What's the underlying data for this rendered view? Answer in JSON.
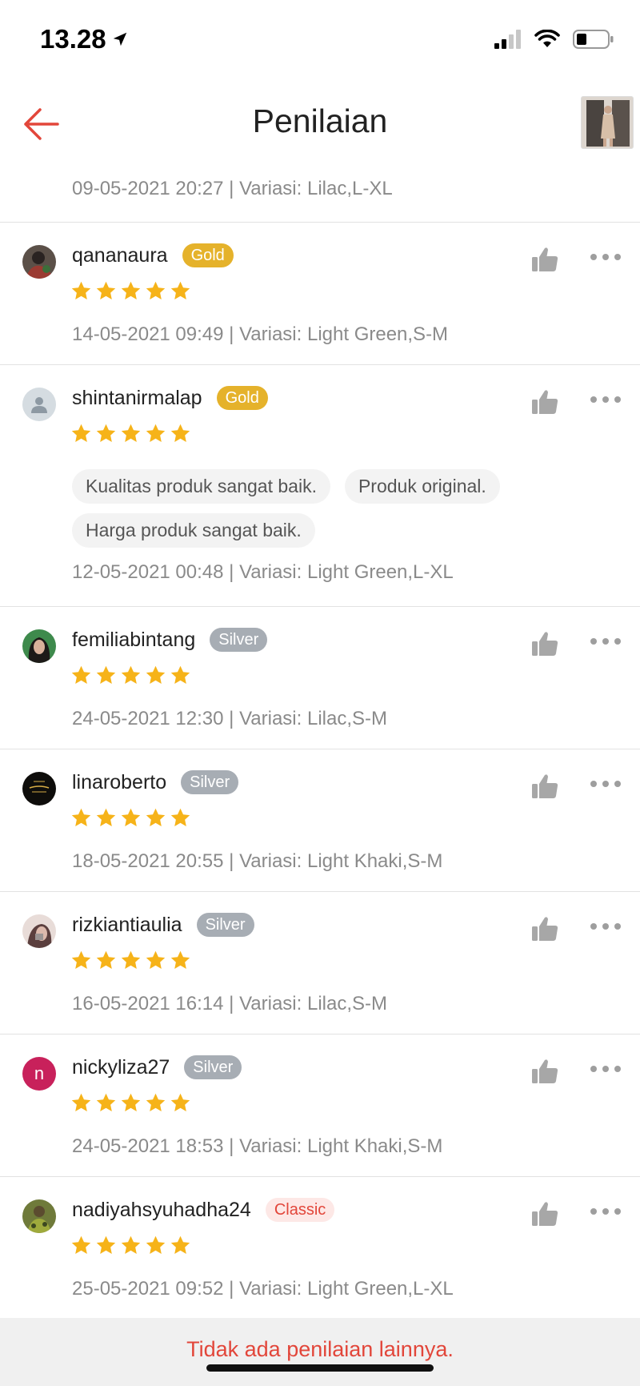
{
  "status_bar": {
    "time": "13.28"
  },
  "header": {
    "title": "Penilaian"
  },
  "partial_review": {
    "meta": "09-05-2021 20:27 | Variasi: Lilac,L-XL"
  },
  "reviews": [
    {
      "username": "qananaura",
      "badge": "Gold",
      "badge_type": "gold",
      "rating": 5,
      "meta": "14-05-2021 09:49 | Variasi: Light Green,S-M",
      "tags": [],
      "avatar_style": "photo-dark"
    },
    {
      "username": "shintanirmalap",
      "badge": "Gold",
      "badge_type": "gold",
      "rating": 5,
      "meta": "12-05-2021 00:48 | Variasi: Light Green,L-XL",
      "tags": [
        "Kualitas produk sangat baik.",
        "Produk original.",
        "Harga produk sangat baik."
      ],
      "avatar_style": "default"
    },
    {
      "username": "femiliabintang",
      "badge": "Silver",
      "badge_type": "silver",
      "rating": 5,
      "meta": "24-05-2021 12:30 | Variasi: Lilac,S-M",
      "tags": [],
      "avatar_style": "photo-green"
    },
    {
      "username": "linaroberto",
      "badge": "Silver",
      "badge_type": "silver",
      "rating": 5,
      "meta": "18-05-2021 20:55 | Variasi: Light Khaki,S-M",
      "tags": [],
      "avatar_style": "photo-black"
    },
    {
      "username": "rizkiantiaulia",
      "badge": "Silver",
      "badge_type": "silver",
      "rating": 5,
      "meta": "16-05-2021 16:14 | Variasi: Lilac,S-M",
      "tags": [],
      "avatar_style": "photo-light"
    },
    {
      "username": "nickyliza27",
      "badge": "Silver",
      "badge_type": "silver",
      "rating": 5,
      "meta": "24-05-2021 18:53 | Variasi: Light Khaki,S-M",
      "tags": [],
      "avatar_style": "letter",
      "avatar_letter": "n"
    },
    {
      "username": "nadiyahsyuhadha24",
      "badge": "Classic",
      "badge_type": "classic",
      "rating": 5,
      "meta": "25-05-2021 09:52 | Variasi: Light Green,L-XL",
      "tags": [],
      "avatar_style": "photo-olive"
    }
  ],
  "footer": {
    "text": "Tidak ada penilaian lainnya."
  },
  "colors": {
    "accent": "#e2463a",
    "star": "#f6b319",
    "gold": "#e5b22b",
    "silver": "#a7adb4"
  },
  "icons": [
    "location-arrow-icon",
    "cellular-signal-icon",
    "wifi-icon",
    "battery-icon",
    "back-arrow-icon",
    "thumbs-up-icon",
    "more-options-icon",
    "star-icon",
    "user-icon"
  ]
}
